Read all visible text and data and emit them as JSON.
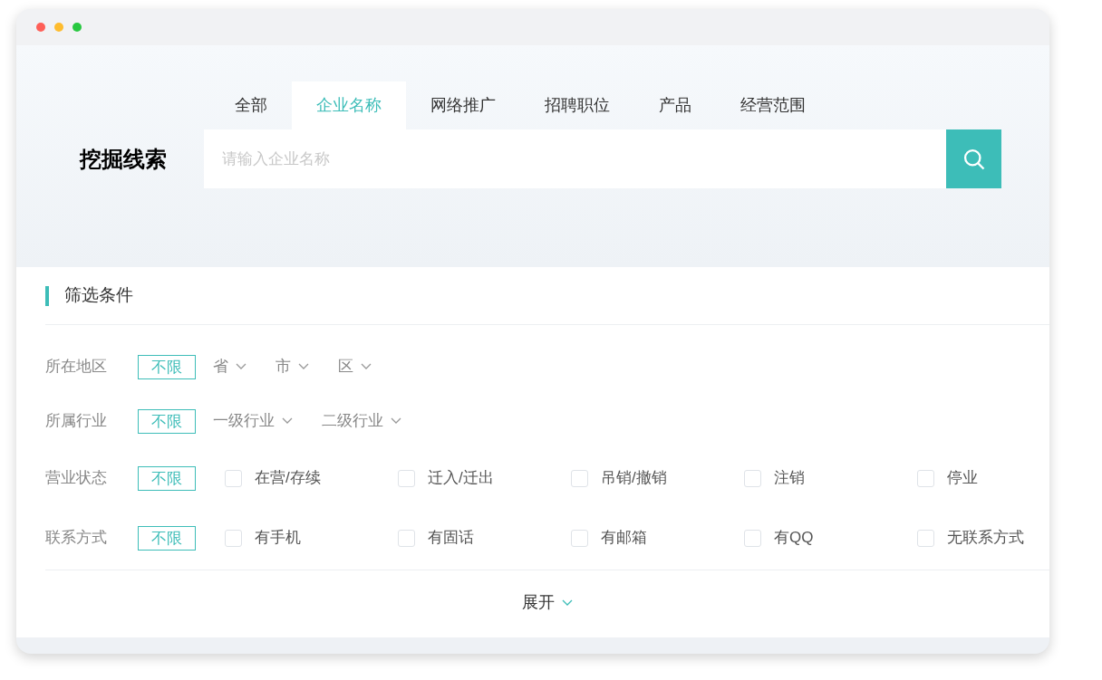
{
  "search": {
    "title": "挖掘线索",
    "placeholder": "请输入企业名称",
    "tabs": [
      {
        "label": "全部",
        "selected": false
      },
      {
        "label": "企业名称",
        "selected": true
      },
      {
        "label": "网络推广",
        "selected": false
      },
      {
        "label": "招聘职位",
        "selected": false
      },
      {
        "label": "产品",
        "selected": false
      },
      {
        "label": "经营范围",
        "selected": false
      }
    ]
  },
  "filters": {
    "title": "筛选条件",
    "rows": [
      {
        "kind": "dropdowns",
        "label": "所在地区",
        "any": {
          "label": "不限",
          "selected": true
        },
        "options": [
          "省",
          "市",
          "区"
        ]
      },
      {
        "kind": "dropdowns",
        "label": "所属行业",
        "any": {
          "label": "不限",
          "selected": true
        },
        "options": [
          "一级行业",
          "二级行业"
        ]
      },
      {
        "kind": "checkboxes",
        "label": "营业状态",
        "any": {
          "label": "不限",
          "selected": true
        },
        "options": [
          {
            "label": "在营/存续",
            "checked": false
          },
          {
            "label": "迁入/迁出",
            "checked": false
          },
          {
            "label": "吊销/撤销",
            "checked": false
          },
          {
            "label": "注销",
            "checked": false
          },
          {
            "label": "停业",
            "checked": false
          }
        ]
      },
      {
        "kind": "checkboxes",
        "label": "联系方式",
        "any": {
          "label": "不限",
          "selected": true
        },
        "options": [
          {
            "label": "有手机",
            "checked": false
          },
          {
            "label": "有固话",
            "checked": false
          },
          {
            "label": "有邮箱",
            "checked": false
          },
          {
            "label": "有QQ",
            "checked": false
          },
          {
            "label": "无联系方式",
            "checked": false
          }
        ]
      }
    ],
    "expand": "展开"
  }
}
